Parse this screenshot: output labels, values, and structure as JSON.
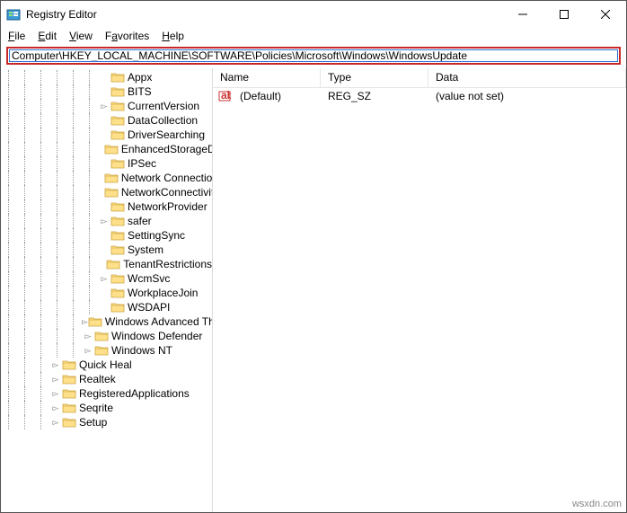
{
  "window": {
    "title": "Registry Editor"
  },
  "menu": {
    "file": "File",
    "edit": "Edit",
    "view": "View",
    "favorites": "Favorites",
    "help": "Help"
  },
  "address": "Computer\\HKEY_LOCAL_MACHINE\\SOFTWARE\\Policies\\Microsoft\\Windows\\WindowsUpdate",
  "list": {
    "headers": {
      "name": "Name",
      "type": "Type",
      "data": "Data"
    },
    "rows": [
      {
        "name": "(Default)",
        "type": "REG_SZ",
        "data": "(value not set)"
      }
    ]
  },
  "tree": [
    {
      "depth": 6,
      "exp": "blank",
      "label": "Appx"
    },
    {
      "depth": 6,
      "exp": "blank",
      "label": "BITS"
    },
    {
      "depth": 6,
      "exp": ">",
      "label": "CurrentVersion"
    },
    {
      "depth": 6,
      "exp": "blank",
      "label": "DataCollection"
    },
    {
      "depth": 6,
      "exp": "blank",
      "label": "DriverSearching"
    },
    {
      "depth": 6,
      "exp": "blank",
      "label": "EnhancedStorageDevices"
    },
    {
      "depth": 6,
      "exp": "blank",
      "label": "IPSec"
    },
    {
      "depth": 6,
      "exp": "blank",
      "label": "Network Connections"
    },
    {
      "depth": 6,
      "exp": "blank",
      "label": "NetworkConnectivityStatusIndicator"
    },
    {
      "depth": 6,
      "exp": "blank",
      "label": "NetworkProvider"
    },
    {
      "depth": 6,
      "exp": ">",
      "label": "safer"
    },
    {
      "depth": 6,
      "exp": "blank",
      "label": "SettingSync"
    },
    {
      "depth": 6,
      "exp": "blank",
      "label": "System"
    },
    {
      "depth": 6,
      "exp": "blank",
      "label": "TenantRestrictions"
    },
    {
      "depth": 6,
      "exp": ">",
      "label": "WcmSvc"
    },
    {
      "depth": 6,
      "exp": "blank",
      "label": "WorkplaceJoin"
    },
    {
      "depth": 6,
      "exp": "blank",
      "label": "WSDAPI"
    },
    {
      "depth": 5,
      "exp": ">",
      "label": "Windows Advanced Threat Protection"
    },
    {
      "depth": 5,
      "exp": ">",
      "label": "Windows Defender"
    },
    {
      "depth": 5,
      "exp": ">",
      "label": "Windows NT"
    },
    {
      "depth": 3,
      "exp": ">",
      "label": "Quick Heal"
    },
    {
      "depth": 3,
      "exp": ">",
      "label": "Realtek"
    },
    {
      "depth": 3,
      "exp": ">",
      "label": "RegisteredApplications"
    },
    {
      "depth": 3,
      "exp": ">",
      "label": "Seqrite"
    },
    {
      "depth": 3,
      "exp": ">",
      "label": "Setup"
    }
  ],
  "watermark": "wsxdn.com"
}
